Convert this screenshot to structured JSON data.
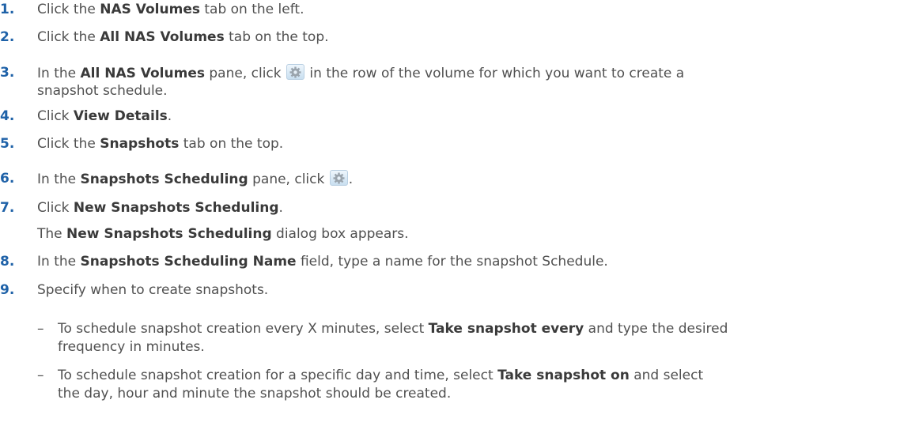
{
  "steps": [
    {
      "num": "1.",
      "pre": "Click the ",
      "bold": "NAS Volumes",
      "post": " tab on the left."
    },
    {
      "num": "2.",
      "pre": "Click the ",
      "bold": "All NAS Volumes",
      "post": " tab on the top."
    },
    {
      "num": "3.",
      "pre": "In the ",
      "bold": "All NAS Volumes",
      "mid": " pane, click ",
      "post": " in the row of the volume for which you want to create a",
      "line2": "snapshot schedule."
    },
    {
      "num": "4.",
      "pre": "Click ",
      "bold": "View Details",
      "post": "."
    },
    {
      "num": "5.",
      "pre": "Click the ",
      "bold": "Snapshots",
      "post": " tab on the top."
    },
    {
      "num": "6.",
      "pre": "In the ",
      "bold": "Snapshots Scheduling",
      "mid": " pane, click ",
      "post": "."
    },
    {
      "num": "7.",
      "pre": "Click ",
      "bold": "New Snapshots Scheduling",
      "post": ".",
      "line2_bold": "New Snapshots Scheduling",
      "line2_pre": "The ",
      "line2_post": " dialog box appears."
    },
    {
      "num": "8.",
      "pre": "In the ",
      "bold": "Snapshots Scheduling Name",
      "post": " field, type a name for the snapshot Schedule."
    },
    {
      "num": "9.",
      "pre": "Specify when to create snapshots.",
      "bold": "",
      "post": ""
    }
  ],
  "subitems": [
    {
      "dash": "–",
      "pre": "To schedule snapshot creation every X minutes, select ",
      "bold": "Take snapshot every",
      "post": " and type the desired",
      "line2": "frequency in minutes."
    },
    {
      "dash": "–",
      "pre": "To schedule snapshot creation for a specific day and time, select ",
      "bold": "Take snapshot on",
      "post": " and select",
      "line2": "the day, hour and minute the snapshot should be created."
    }
  ],
  "icons": {
    "gear": "gear-icon"
  }
}
